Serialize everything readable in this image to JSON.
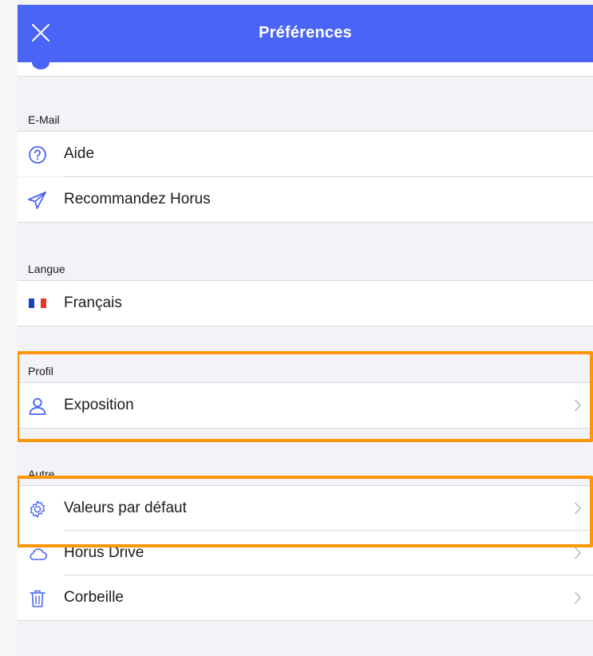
{
  "navbar": {
    "title": "Préférences",
    "close_icon": "close-icon"
  },
  "sections": {
    "email": {
      "header": "E-Mail",
      "items": [
        {
          "label": "Aide",
          "icon": "help-circle-icon"
        },
        {
          "label": "Recommandez Horus",
          "icon": "paper-plane-icon"
        }
      ]
    },
    "language": {
      "header": "Langue",
      "items": [
        {
          "label": "Français",
          "icon": "france-flag-icon"
        }
      ]
    },
    "profile": {
      "header": "Profil",
      "items": [
        {
          "label": "Exposition",
          "icon": "user-icon",
          "chevron": true
        }
      ]
    },
    "other": {
      "header": "Autre",
      "items": [
        {
          "label": "Valeurs par défaut",
          "icon": "gear-icon",
          "chevron": true
        },
        {
          "label": "Horus Drive",
          "icon": "cloud-icon",
          "chevron": true
        },
        {
          "label": "Corbeille",
          "icon": "trash-icon",
          "chevron": true
        }
      ]
    }
  },
  "colors": {
    "accent": "#4a64f5",
    "highlight": "#ff9500",
    "background": "#f2f2f7",
    "separator": "#d8d8dc"
  }
}
